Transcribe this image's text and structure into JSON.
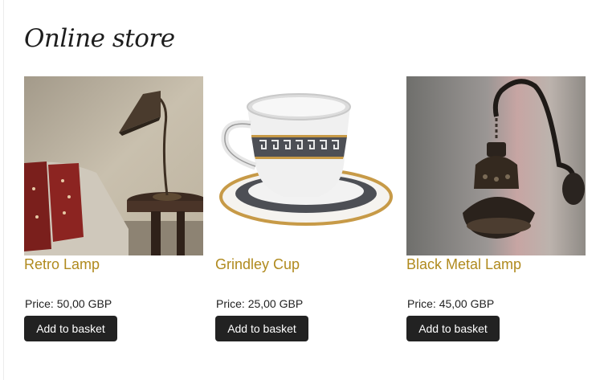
{
  "page": {
    "title": "Online store"
  },
  "products": [
    {
      "name": "Retro Lamp",
      "price_label": "Price:",
      "price": "50,00 GBP",
      "button_label": "Add to basket"
    },
    {
      "name": "Grindley Cup",
      "price_label": "Price:",
      "price": "25,00 GBP",
      "button_label": "Add to basket"
    },
    {
      "name": "Black Metal Lamp",
      "price_label": "Price:",
      "price": "45,00 GBP",
      "button_label": "Add to basket"
    }
  ],
  "colors": {
    "product_name": "#b08a1e",
    "button_bg": "#222222",
    "button_text": "#ffffff"
  }
}
